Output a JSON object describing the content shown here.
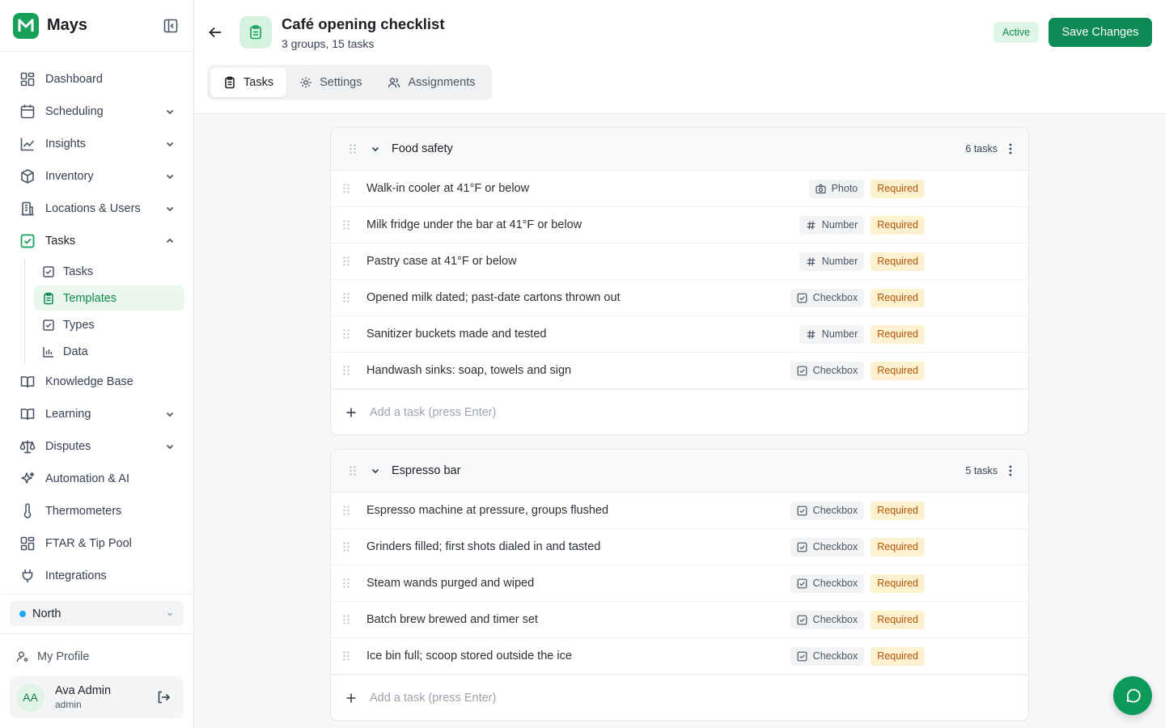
{
  "brand": {
    "name": "Mays"
  },
  "sidebar": {
    "items": [
      {
        "label": "Dashboard",
        "icon": "grid-icon",
        "has_chevron": false
      },
      {
        "label": "Scheduling",
        "icon": "calendar-icon",
        "has_chevron": true
      },
      {
        "label": "Insights",
        "icon": "chart-line-icon",
        "has_chevron": true
      },
      {
        "label": "Inventory",
        "icon": "box-icon",
        "has_chevron": true
      },
      {
        "label": "Locations & Users",
        "icon": "building-icon",
        "has_chevron": true
      },
      {
        "label": "Tasks",
        "icon": "check-square-icon",
        "has_chevron": true,
        "expanded": true
      },
      {
        "label": "Knowledge Base",
        "icon": "book-icon",
        "has_chevron": false
      },
      {
        "label": "Learning",
        "icon": "book-open-icon",
        "has_chevron": true
      },
      {
        "label": "Disputes",
        "icon": "scale-icon",
        "has_chevron": true
      },
      {
        "label": "Automation & AI",
        "icon": "sparkles-icon",
        "has_chevron": false
      },
      {
        "label": "Thermometers",
        "icon": "thermometer-icon",
        "has_chevron": false
      },
      {
        "label": "FTAR & Tip Pool",
        "icon": "grid-icon",
        "has_chevron": false
      },
      {
        "label": "Integrations",
        "icon": "plug-icon",
        "has_chevron": false
      }
    ],
    "task_subitems": [
      {
        "label": "Tasks",
        "icon": "check-square-icon",
        "active": false
      },
      {
        "label": "Templates",
        "icon": "clipboard-icon",
        "active": true
      },
      {
        "label": "Types",
        "icon": "check-square-icon",
        "active": false
      },
      {
        "label": "Data",
        "icon": "bar-chart-icon",
        "active": false
      }
    ],
    "location": {
      "label": "North",
      "dot_color": "#1ea7f3"
    },
    "profile_link": "My Profile",
    "user": {
      "initials": "AA",
      "name": "Ava Admin",
      "role": "admin"
    }
  },
  "header": {
    "title": "Café opening checklist",
    "subtitle": "3 groups, 15 tasks",
    "status": "Active",
    "save_label": "Save Changes",
    "tabs": [
      {
        "label": "Tasks",
        "icon": "clipboard-icon",
        "active": true
      },
      {
        "label": "Settings",
        "icon": "gear-icon",
        "active": false
      },
      {
        "label": "Assignments",
        "icon": "users-icon",
        "active": false
      }
    ]
  },
  "groups": [
    {
      "name": "Food safety",
      "count": "6 tasks",
      "add_placeholder": "Add a task (press Enter)",
      "tasks": [
        {
          "name": "Walk-in cooler at 41°F or below",
          "type": "Photo",
          "type_icon": "camera-icon",
          "required": "Required"
        },
        {
          "name": "Milk fridge under the bar at 41°F or below",
          "type": "Number",
          "type_icon": "hash-icon",
          "required": "Required"
        },
        {
          "name": "Pastry case at 41°F or below",
          "type": "Number",
          "type_icon": "hash-icon",
          "required": "Required"
        },
        {
          "name": "Opened milk dated; past-date cartons thrown out",
          "type": "Checkbox",
          "type_icon": "checkbox-icon",
          "required": "Required"
        },
        {
          "name": "Sanitizer buckets made and tested",
          "type": "Number",
          "type_icon": "hash-icon",
          "required": "Required"
        },
        {
          "name": "Handwash sinks: soap, towels and sign",
          "type": "Checkbox",
          "type_icon": "checkbox-icon",
          "required": "Required"
        }
      ]
    },
    {
      "name": "Espresso bar",
      "count": "5 tasks",
      "add_placeholder": "Add a task (press Enter)",
      "tasks": [
        {
          "name": "Espresso machine at pressure, groups flushed",
          "type": "Checkbox",
          "type_icon": "checkbox-icon",
          "required": "Required"
        },
        {
          "name": "Grinders filled; first shots dialed in and tasted",
          "type": "Checkbox",
          "type_icon": "checkbox-icon",
          "required": "Required"
        },
        {
          "name": "Steam wands purged and wiped",
          "type": "Checkbox",
          "type_icon": "checkbox-icon",
          "required": "Required"
        },
        {
          "name": "Batch brew brewed and timer set",
          "type": "Checkbox",
          "type_icon": "checkbox-icon",
          "required": "Required"
        },
        {
          "name": "Ice bin full; scoop stored outside the ice",
          "type": "Checkbox",
          "type_icon": "checkbox-icon",
          "required": "Required"
        }
      ]
    }
  ],
  "colors": {
    "accent": "#17a05a",
    "primary_button": "#0e8a55",
    "required_bg": "#fdf1cf",
    "required_text": "#b45309"
  }
}
